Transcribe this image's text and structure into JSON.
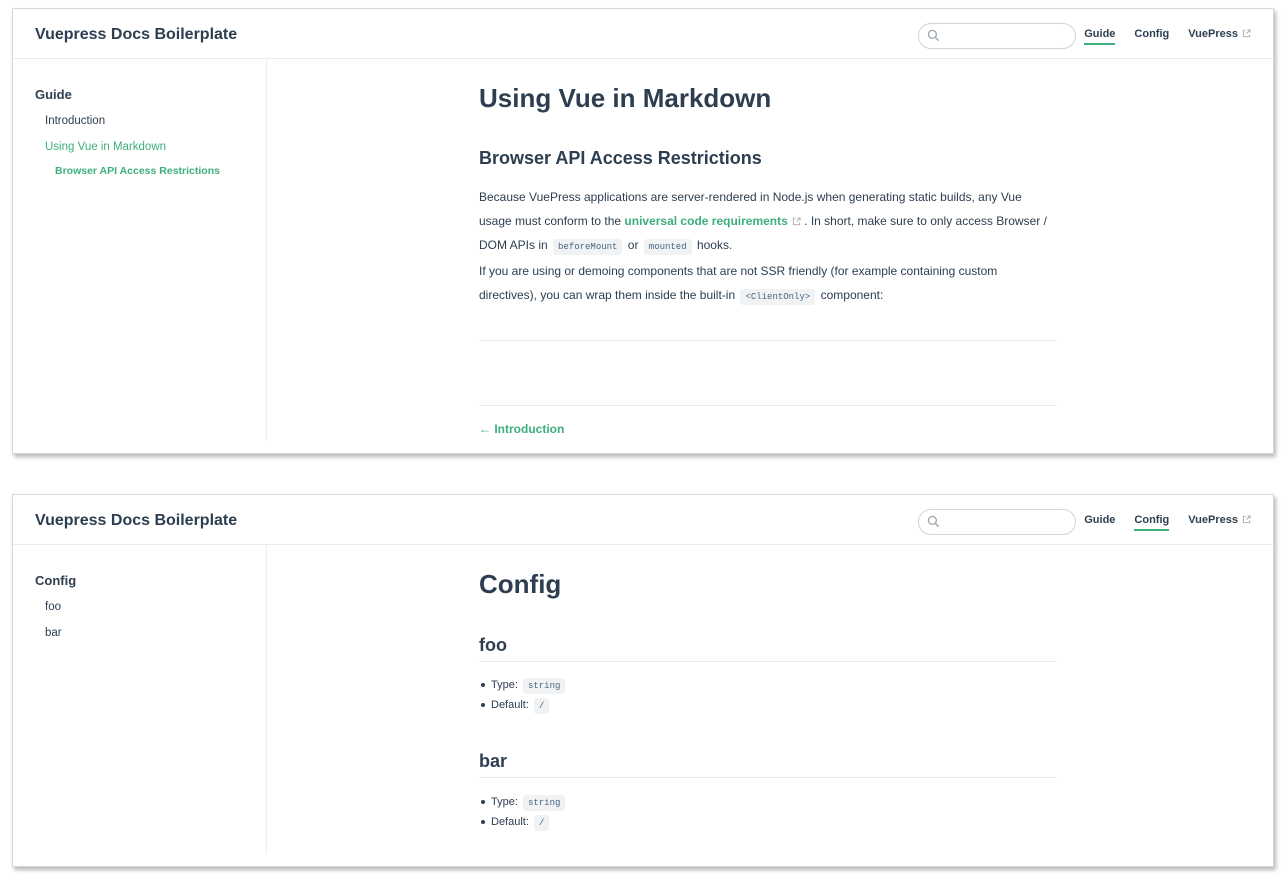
{
  "colors": {
    "accent": "#3eaf7c",
    "text": "#2c3e50",
    "border": "#eaecef",
    "code_bg": "#f1f2f4"
  },
  "icons": {
    "search": "search-icon",
    "external": "external-link-icon"
  },
  "windows": [
    {
      "navbar": {
        "site_title": "Vuepress Docs Boilerplate",
        "search_value": "",
        "links": {
          "guide": "Guide",
          "config": "Config",
          "vuepress": "VuePress"
        },
        "active": "Guide"
      },
      "sidebar": {
        "group": "Guide",
        "items": [
          "Introduction",
          "Using Vue in Markdown"
        ],
        "active_item": "Using Vue in Markdown",
        "sub_item": "Browser API Access Restrictions"
      },
      "content": {
        "title": "Using Vue in Markdown",
        "section": "Browser API Access Restrictions",
        "p1": {
          "a": "Because VuePress applications are server-rendered in Node.js when generating static builds, any Vue usage must conform to the ",
          "link": "universal code requirements",
          "b": " . In short, make sure to only access Browser / DOM APIs in ",
          "code1": "beforeMount",
          "c": " or ",
          "code2": "mounted",
          "d": " hooks."
        },
        "p2": {
          "a": "If you are using or demoing components that are not SSR friendly (for example containing custom directives), you can wrap them inside the built-in ",
          "code": "<ClientOnly>",
          "b": " component:"
        },
        "prev_link": "← Introduction"
      }
    },
    {
      "navbar": {
        "site_title": "Vuepress Docs Boilerplate",
        "search_value": "",
        "links": {
          "guide": "Guide",
          "config": "Config",
          "vuepress": "VuePress"
        },
        "active": "Config"
      },
      "sidebar": {
        "group": "Config",
        "items": [
          "foo",
          "bar"
        ]
      },
      "content": {
        "title": "Config",
        "sections": [
          {
            "heading": "foo",
            "type_label": "Type:",
            "type_value": "string",
            "default_label": "Default:",
            "default_value": "/"
          },
          {
            "heading": "bar",
            "type_label": "Type:",
            "type_value": "string",
            "default_label": "Default:",
            "default_value": "/"
          }
        ]
      }
    }
  ]
}
